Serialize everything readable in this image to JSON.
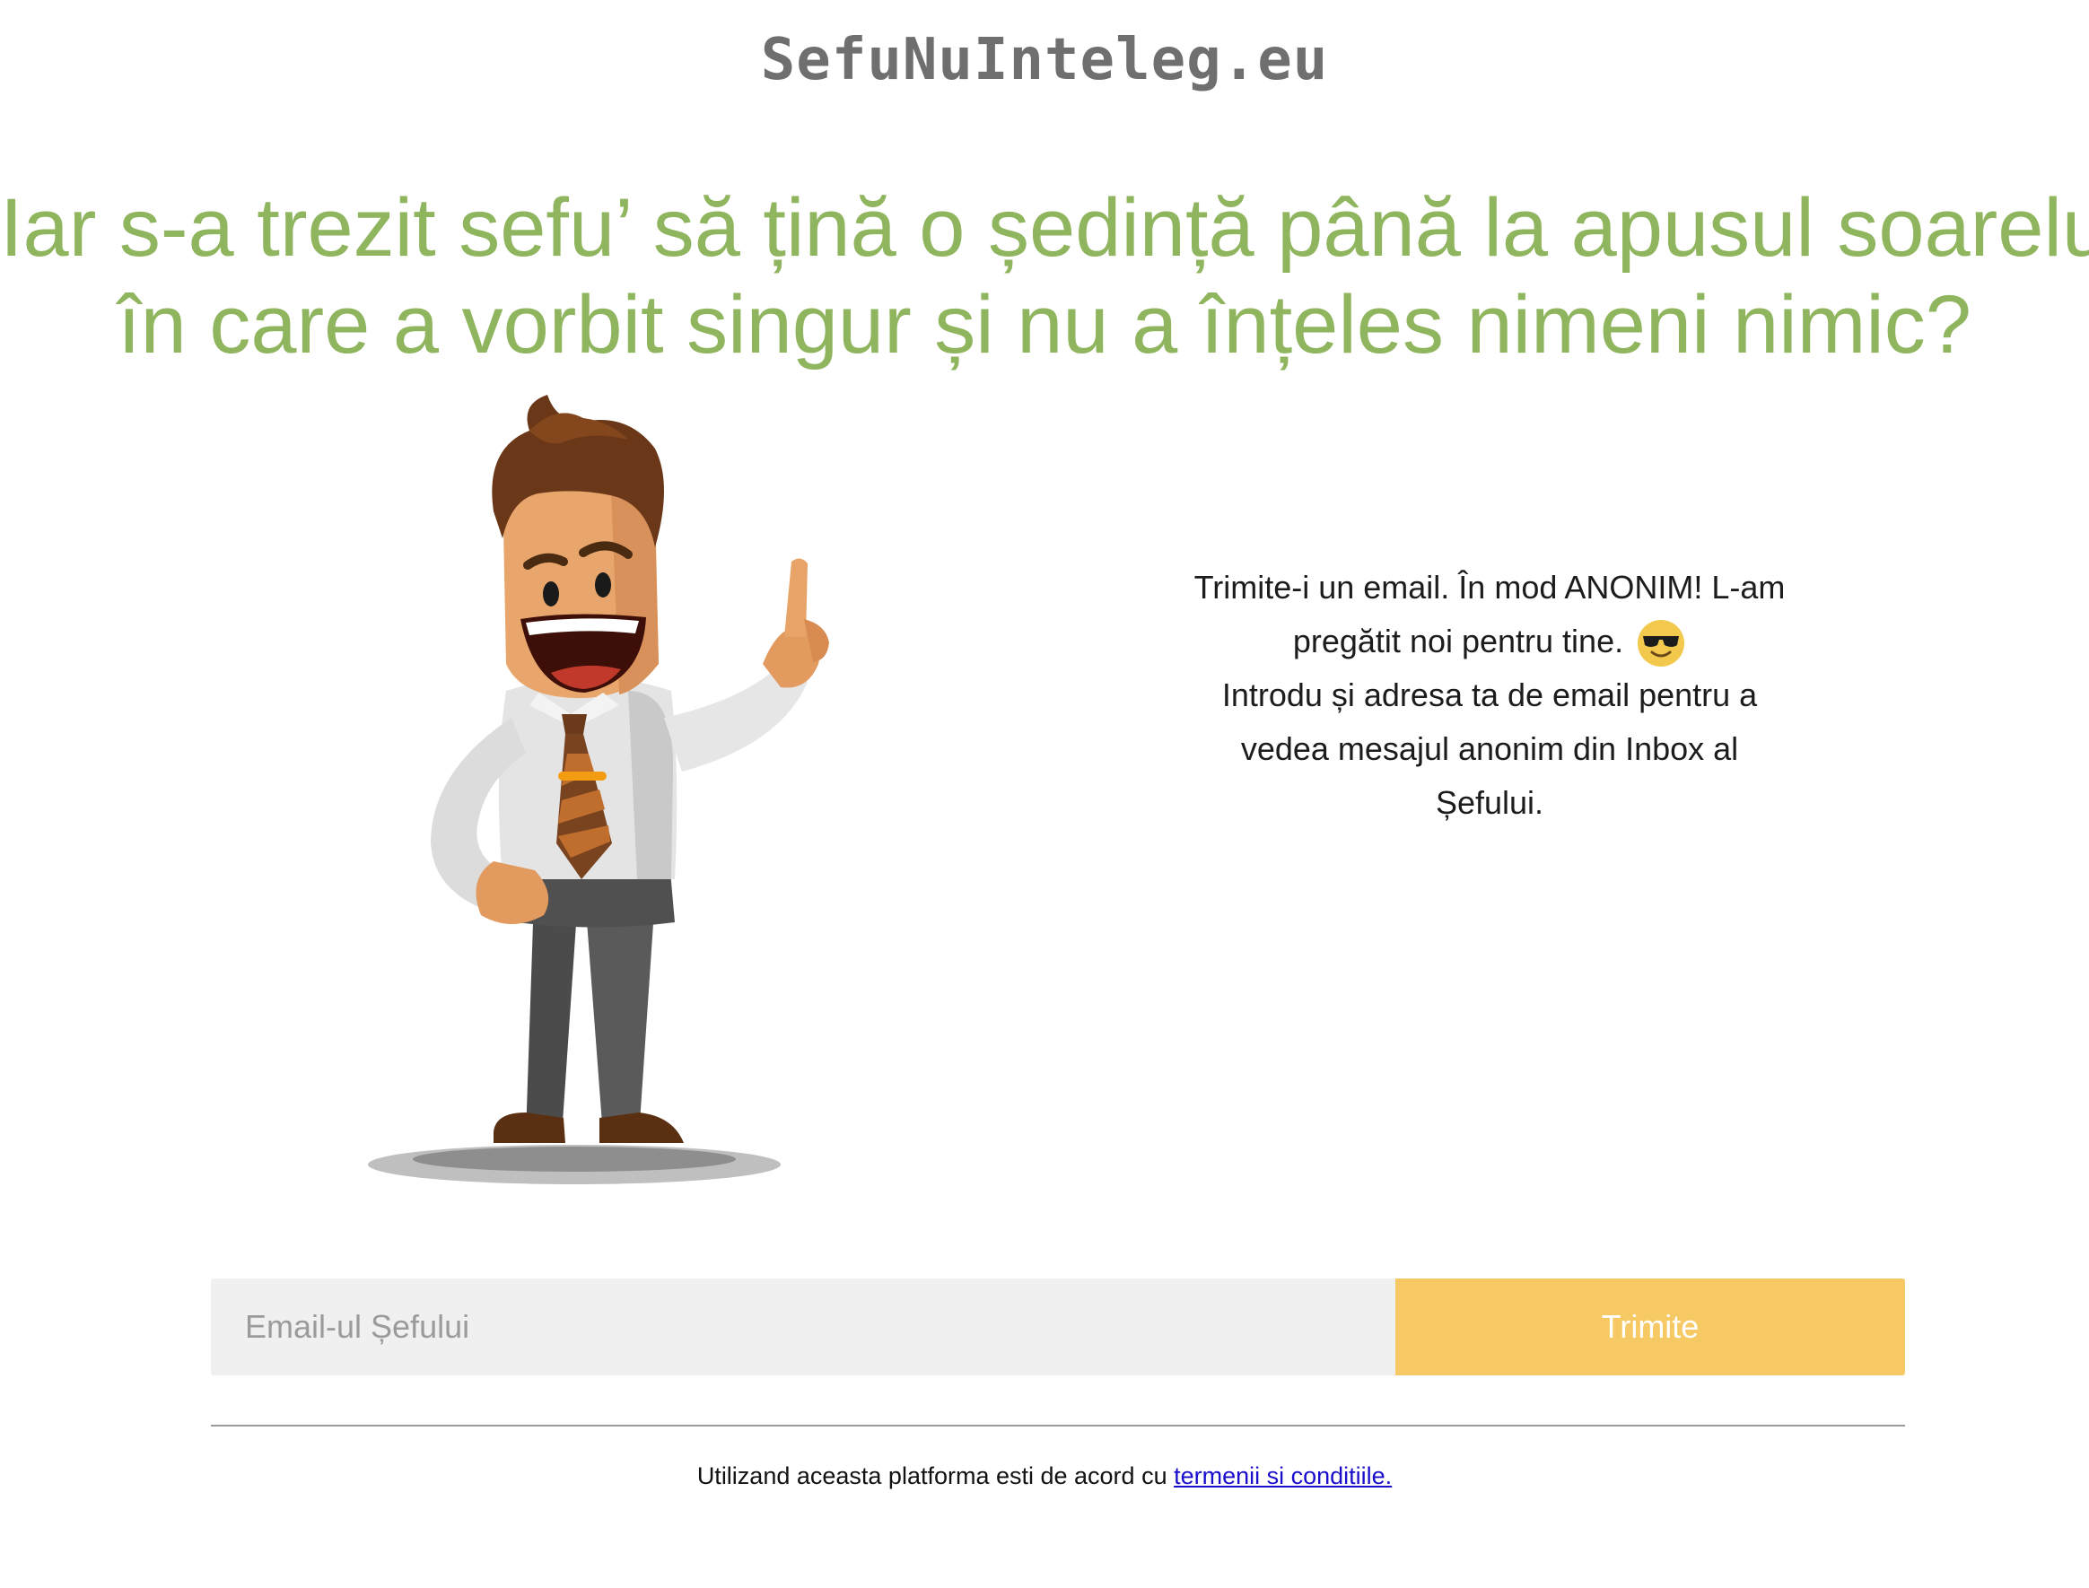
{
  "header": {
    "site_title": "SefuNuInteleg.eu"
  },
  "hero": {
    "headline_line1": "Iar s-a trezit sefu’ să țină o ședință până la apusul soarelui",
    "headline_line2": "în care a vorbit singur și nu a înțeles nimeni nimic?",
    "headline_color": "#8fb55e"
  },
  "info": {
    "line1": "Trimite-i un email. În mod ANONIM! L-am",
    "line2": "pregătit noi pentru tine.",
    "line2_icon": "sunglasses-emoji-icon",
    "line3": "Introdu și adresa ta de email pentru a",
    "line4": "vedea mesajul anonim din Inbox al",
    "line5": "Șefului."
  },
  "form": {
    "email_value": "",
    "email_placeholder": "Email-ul Șefului",
    "submit_label": "Trimite",
    "submit_color": "#f7c964"
  },
  "footer": {
    "text": "Utilizand aceasta platforma esti de acord cu ",
    "link_label": "termenii si conditiile."
  }
}
